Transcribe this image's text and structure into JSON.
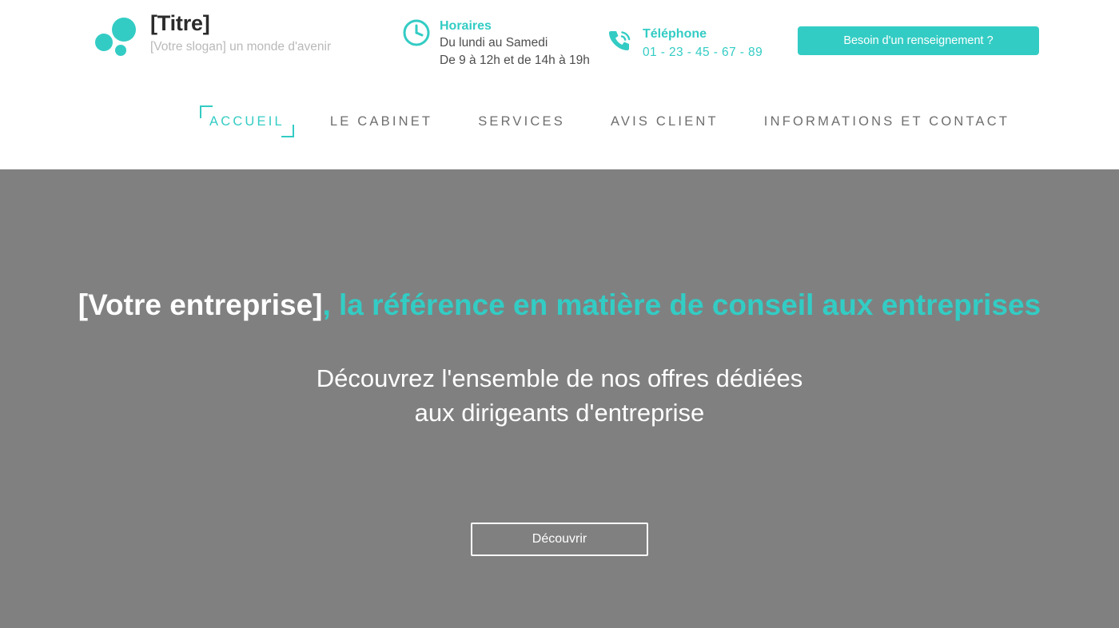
{
  "theme": {
    "accent": "#33ccc4",
    "hero_background": "#808080",
    "header_background": "#ffffff",
    "title_color": "#2b2b2b",
    "slogan_color": "#b9b9b9",
    "nav_color": "#6e6e6e"
  },
  "header": {
    "brand": {
      "title": "[Titre]",
      "slogan": "[Votre slogan] un monde d'avenir",
      "logo_icon": "three-dots-logo"
    },
    "hours": {
      "icon": "clock-icon",
      "label": "Horaires",
      "line1": "Du lundi au Samedi",
      "line2": "De 9 à 12h et de 14h à 19h"
    },
    "phone": {
      "icon": "phone-ringing-icon",
      "label": "Téléphone",
      "number": "01 - 23 - 45 - 67 - 89"
    },
    "cta": {
      "label": "Besoin d'un renseignement ?"
    }
  },
  "nav": {
    "items": [
      {
        "label": "ACCUEIL",
        "active": true
      },
      {
        "label": "LE CABINET",
        "active": false
      },
      {
        "label": "SERVICES",
        "active": false
      },
      {
        "label": "AVIS CLIENT",
        "active": false
      },
      {
        "label": "INFORMATIONS ET CONTACT",
        "active": false
      }
    ]
  },
  "hero": {
    "headline_primary": "[Votre entreprise]",
    "headline_accent": ", la référence en matière de conseil aux entreprises",
    "subheadline_line1": "Découvrez l'ensemble de nos offres dédiées",
    "subheadline_line2": "aux dirigeants d'entreprise",
    "discover_label": "Découvrir"
  }
}
